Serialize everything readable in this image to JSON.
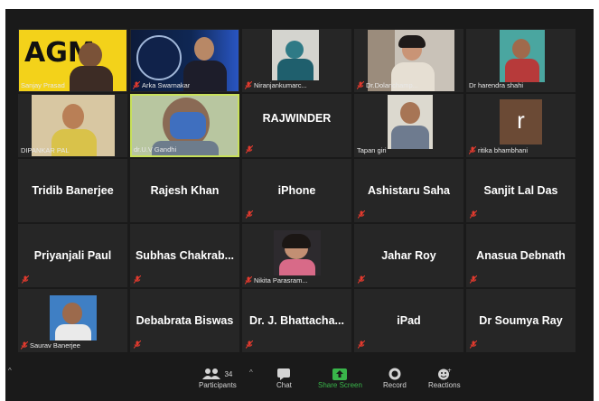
{
  "participants": [
    {
      "label": "Sanjay Prasad",
      "muted": false,
      "type": "video",
      "row": 0,
      "col": 0
    },
    {
      "label": "Arka Swarnakar",
      "muted": true,
      "type": "video",
      "row": 0,
      "col": 1
    },
    {
      "label": "Niranjankumarc...",
      "muted": true,
      "type": "video",
      "row": 0,
      "col": 2
    },
    {
      "label": "Dr.Dolanchamp...",
      "muted": true,
      "type": "video",
      "row": 0,
      "col": 3
    },
    {
      "label": "Dr harendra shahi",
      "muted": false,
      "type": "video",
      "row": 0,
      "col": 4
    },
    {
      "label": "DIPANKAR PAL",
      "muted": false,
      "type": "video",
      "row": 1,
      "col": 0
    },
    {
      "label": "dr.U.V Gandhi",
      "muted": false,
      "type": "video",
      "row": 1,
      "col": 1,
      "active": true
    },
    {
      "name": "RAJWINDER",
      "muted": true,
      "type": "name",
      "row": 1,
      "col": 2
    },
    {
      "label": "Tapan giri",
      "muted": false,
      "type": "video",
      "row": 1,
      "col": 3
    },
    {
      "label": "ritika bhambhani",
      "muted": true,
      "type": "letter",
      "letter": "r",
      "row": 1,
      "col": 4
    },
    {
      "name": "Tridib Banerjee",
      "muted": false,
      "type": "name"
    },
    {
      "name": "Rajesh  Khan",
      "muted": false,
      "type": "name"
    },
    {
      "name": "iPhone",
      "muted": true,
      "type": "name"
    },
    {
      "name": "Ashistaru Saha",
      "muted": true,
      "type": "name"
    },
    {
      "name": "Sanjit Lal Das",
      "muted": true,
      "type": "name"
    },
    {
      "name": "Priyanjali Paul",
      "muted": true,
      "type": "name"
    },
    {
      "name": "Subhas  Chakrab...",
      "muted": true,
      "type": "name"
    },
    {
      "label": "Nikita Parasram...",
      "muted": true,
      "type": "video"
    },
    {
      "name": "Jahar Roy",
      "muted": true,
      "type": "name"
    },
    {
      "name": "Anasua Debnath",
      "muted": true,
      "type": "name"
    },
    {
      "label": "Saurav Banerjee",
      "muted": true,
      "type": "video"
    },
    {
      "name": "Debabrata Biswas",
      "muted": true,
      "type": "name"
    },
    {
      "name": "Dr. J.  Bhattacha...",
      "muted": true,
      "type": "name"
    },
    {
      "name": "iPad",
      "muted": true,
      "type": "name"
    },
    {
      "name": "Dr Soumya Ray",
      "muted": true,
      "type": "name"
    }
  ],
  "banner_text": "AGM",
  "toolbar": {
    "participants_label": "Participants",
    "participants_count": "34",
    "chat_label": "Chat",
    "share_label": "Share Screen",
    "record_label": "Record",
    "reactions_label": "Reactions"
  },
  "colors": {
    "background": "#1a1a1a",
    "tile": "#262626",
    "active_border": "#c8e05a",
    "muted_mic": "#e23a2e",
    "share": "#39b54a"
  }
}
